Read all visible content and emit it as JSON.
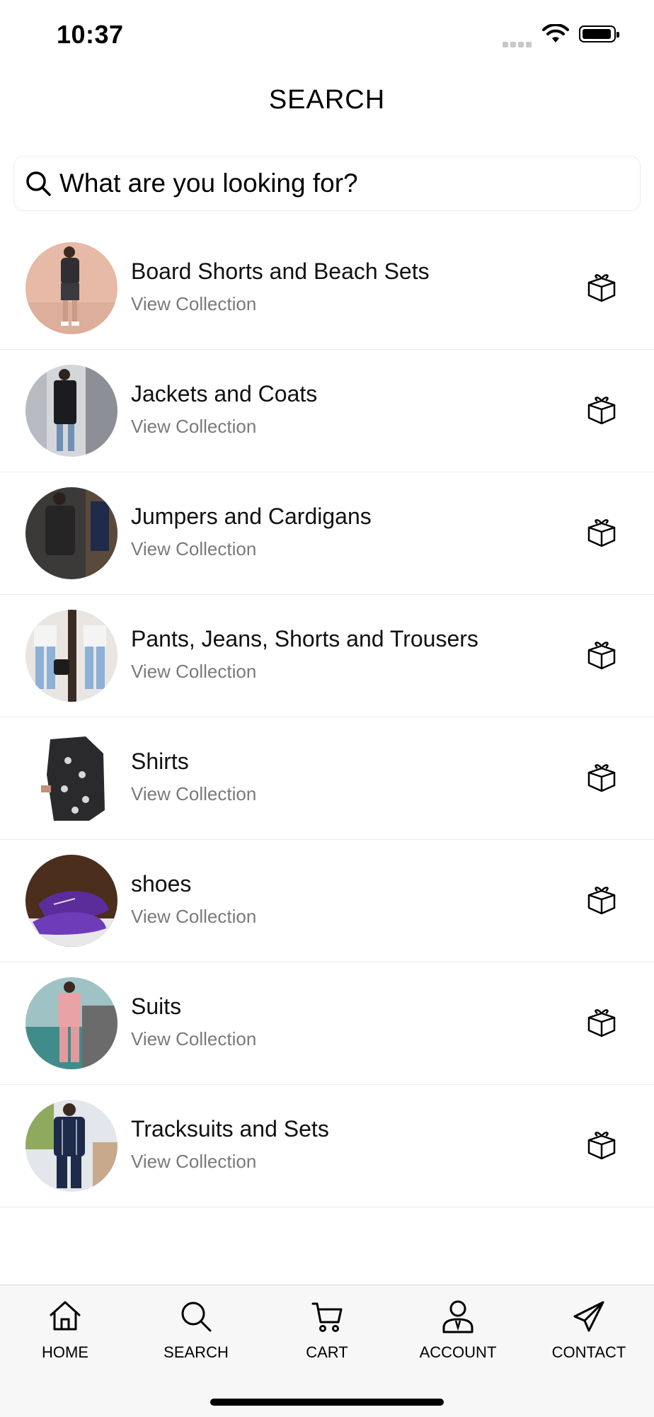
{
  "status_bar": {
    "time": "10:37"
  },
  "header": {
    "title": "SEARCH"
  },
  "search": {
    "placeholder": "What are you looking for?"
  },
  "collections": [
    {
      "title": "Board Shorts and Beach Sets",
      "subtitle": "View Collection",
      "thumbnail": "board-shorts-photo"
    },
    {
      "title": "Jackets and Coats",
      "subtitle": "View Collection",
      "thumbnail": "jackets-photo"
    },
    {
      "title": "Jumpers and Cardigans",
      "subtitle": "View Collection",
      "thumbnail": "jumpers-photo"
    },
    {
      "title": "Pants, Jeans, Shorts and Trousers",
      "subtitle": "View Collection",
      "thumbnail": "pants-photo"
    },
    {
      "title": "Shirts",
      "subtitle": "View Collection",
      "thumbnail": "shirts-photo"
    },
    {
      "title": "shoes",
      "subtitle": "View Collection",
      "thumbnail": "shoes-photo"
    },
    {
      "title": "Suits",
      "subtitle": "View Collection",
      "thumbnail": "suits-photo"
    },
    {
      "title": "Tracksuits and Sets",
      "subtitle": "View Collection",
      "thumbnail": "tracksuits-photo"
    }
  ],
  "row_icon": "gift-box-icon",
  "tabbar": {
    "items": [
      {
        "label": "HOME",
        "icon": "home-icon"
      },
      {
        "label": "SEARCH",
        "icon": "search-icon"
      },
      {
        "label": "CART",
        "icon": "cart-icon"
      },
      {
        "label": "ACCOUNT",
        "icon": "account-icon"
      },
      {
        "label": "CONTACT",
        "icon": "paper-plane-icon"
      }
    ]
  }
}
